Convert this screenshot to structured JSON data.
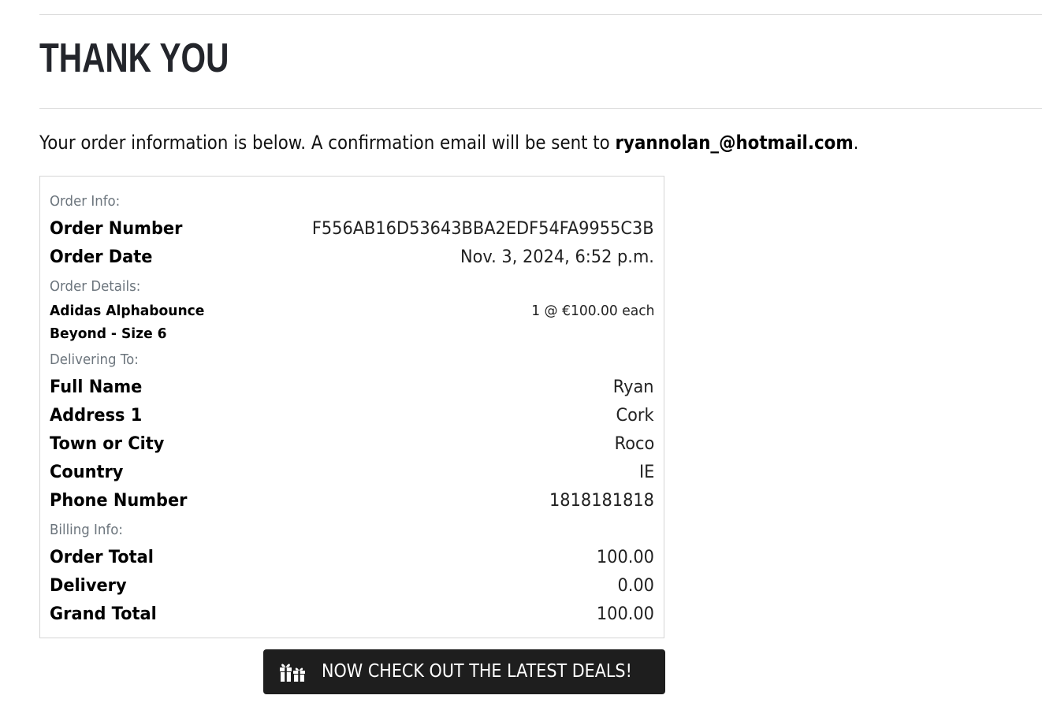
{
  "page": {
    "title": "THANK YOU",
    "intro_text": "Your order information is below. A confirmation email will be sent to ",
    "email": "ryannolan_@hotmail.com",
    "intro_end": "."
  },
  "order_info": {
    "label": "Order Info:",
    "number_label": "Order Number",
    "number_value": "F556AB16D53643BBA2EDF54FA9955C3B",
    "date_label": "Order Date",
    "date_value": "Nov. 3, 2024, 6:52 p.m."
  },
  "order_details": {
    "label": "Order Details:",
    "items": [
      {
        "name": "Adidas Alphabounce Beyond - Size 6",
        "quantity_price": "1 @ €100.00 each"
      }
    ]
  },
  "delivery": {
    "label": "Delivering To:",
    "full_name_label": "Full Name",
    "full_name_value": "Ryan",
    "address1_label": "Address 1",
    "address1_value": "Cork",
    "town_label": "Town or City",
    "town_value": "Roco",
    "country_label": "Country",
    "country_value": "IE",
    "phone_label": "Phone Number",
    "phone_value": "1818181818"
  },
  "billing": {
    "label": "Billing Info:",
    "order_total_label": "Order Total",
    "order_total_value": "100.00",
    "delivery_label": "Delivery",
    "delivery_value": "0.00",
    "grand_total_label": "Grand Total",
    "grand_total_value": "100.00"
  },
  "cta": {
    "label": "NOW CHECK OUT THE LATEST DEALS!",
    "icon": "gifts-icon"
  },
  "colors": {
    "button_bg": "#1e1e1e",
    "muted_label": "#6c757d",
    "heading": "#23252b"
  }
}
